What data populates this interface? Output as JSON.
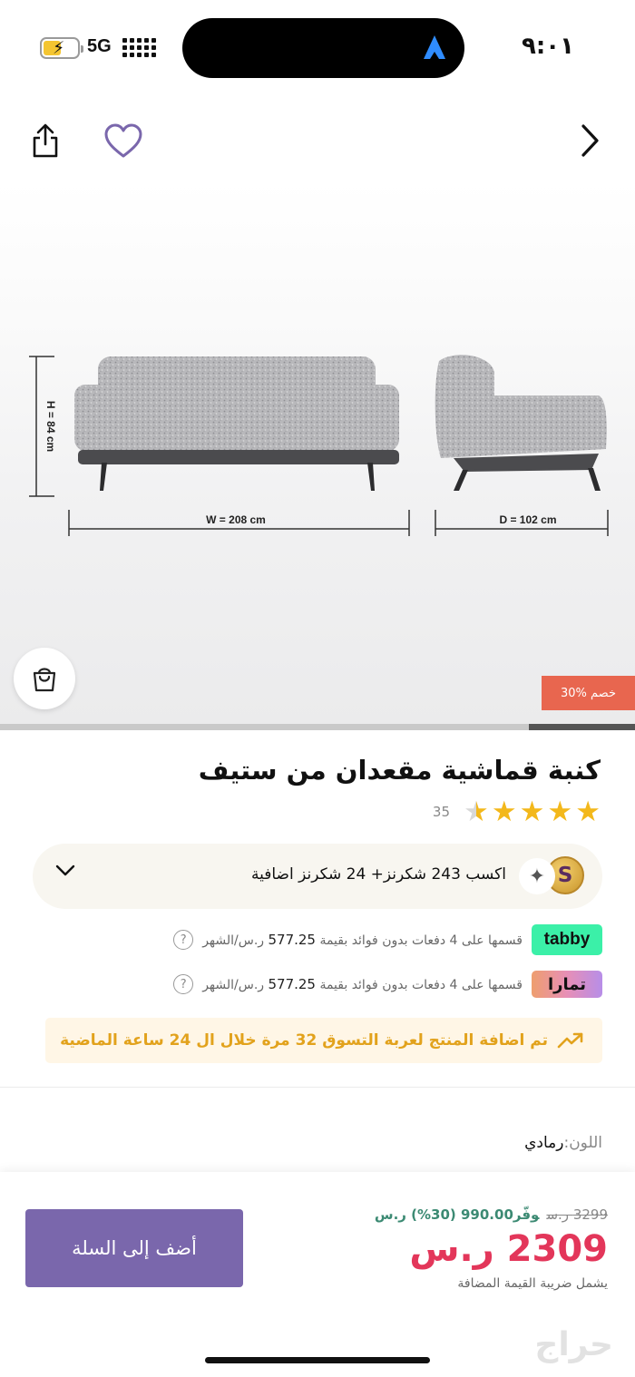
{
  "status_bar": {
    "network": "5G",
    "time": "٩:٠١"
  },
  "product": {
    "title": "كنبة قماشية مقعدان من ستيف",
    "discount_badge": "30% خصم",
    "rating": {
      "stars": 4.5,
      "count": "35"
    },
    "dimensions": {
      "height": "H = 84 cm",
      "width": "W = 208 cm",
      "depth": "D = 102 cm"
    }
  },
  "points": {
    "coin_letter": "S",
    "text": "اكسب 243 شكرنز+  24 شكرنز اضافية"
  },
  "installments": [
    {
      "provider": "tabby",
      "text": "قسمها على 4 دفعات بدون فوائد بقيمة",
      "amount": "577.25",
      "currency_period": "ر.س/الشهر",
      "help": "?"
    },
    {
      "provider": "تمارا",
      "text": "قسمها على 4 دفعات بدون فوائد بقيمة",
      "amount": "577.25",
      "currency_period": "ر.س/الشهر",
      "help": "?"
    }
  ],
  "hot_banner": {
    "text": "تم اضافة المنتج لعربة التسوق 32 مرة خلال ال 24 ساعة الماضية"
  },
  "color_option": {
    "label": "اللون:",
    "value": "رمادي"
  },
  "bottom_bar": {
    "old_price": "3299 ر.س",
    "saving": "وفّر990.00 (30%) ر.س",
    "price": "2309 ر.س",
    "vat_note": "يشمل ضريبة القيمة المضافة",
    "add_to_cart": "أضف إلى السلة",
    "watermark": "حراج"
  },
  "colors": {
    "primary_button": "#7a67ac",
    "price": "#e3365a",
    "saving": "#3c8a73",
    "star": "#f3b81b",
    "hot_banner_text": "#e2a21c",
    "discount_tag": "#e8664f",
    "tabby": "#3bf0a8"
  }
}
